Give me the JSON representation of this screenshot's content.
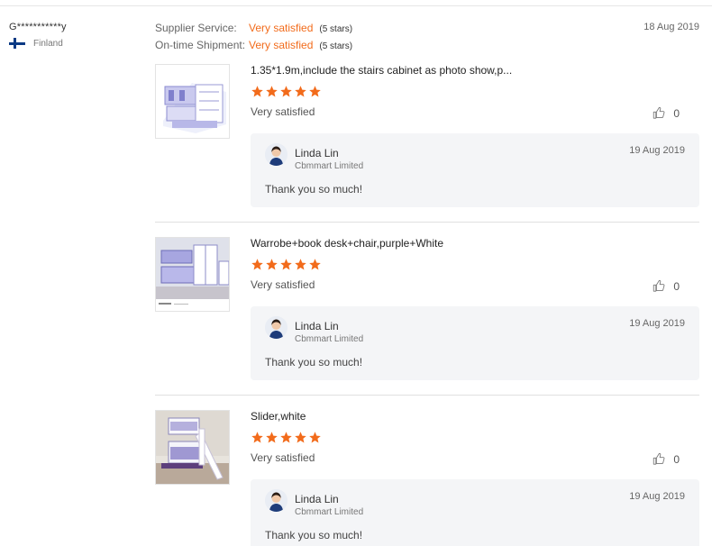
{
  "buyer": {
    "name": "G***********y",
    "country": "Finland"
  },
  "ratings": [
    {
      "label": "Supplier Service:",
      "value": "Very satisfied",
      "stars": "(5 stars)"
    },
    {
      "label": "On-time Shipment:",
      "value": "Very satisfied",
      "stars": "(5 stars)"
    }
  ],
  "review_date": "18 Aug 2019",
  "items": [
    {
      "title": "1.35*1.9m,include the stairs cabinet as photo show,p...",
      "star_rating": 5,
      "satisfaction": "Very satisfied",
      "likes": "0",
      "reply": {
        "name": "Linda Lin",
        "company": "Cbmmart Limited",
        "date": "19 Aug 2019",
        "text": "Thank you so much!"
      }
    },
    {
      "title": "Warrobe+book desk+chair,purple+White",
      "star_rating": 5,
      "satisfaction": "Very satisfied",
      "likes": "0",
      "reply": {
        "name": "Linda Lin",
        "company": "Cbmmart Limited",
        "date": "19 Aug 2019",
        "text": "Thank you so much!"
      }
    },
    {
      "title": "Slider,white",
      "star_rating": 5,
      "satisfaction": "Very satisfied",
      "likes": "0",
      "reply": {
        "name": "Linda Lin",
        "company": "Cbmmart Limited",
        "date": "19 Aug 2019",
        "text": "Thank you so much!"
      }
    }
  ],
  "colors": {
    "accent": "#f26b1b",
    "reply_bg": "#f4f5f7",
    "flag_blue": "#0b3a84"
  },
  "icons": {
    "star": "star-icon",
    "like": "thumbs-up-icon",
    "flag": "finland-flag-icon"
  }
}
